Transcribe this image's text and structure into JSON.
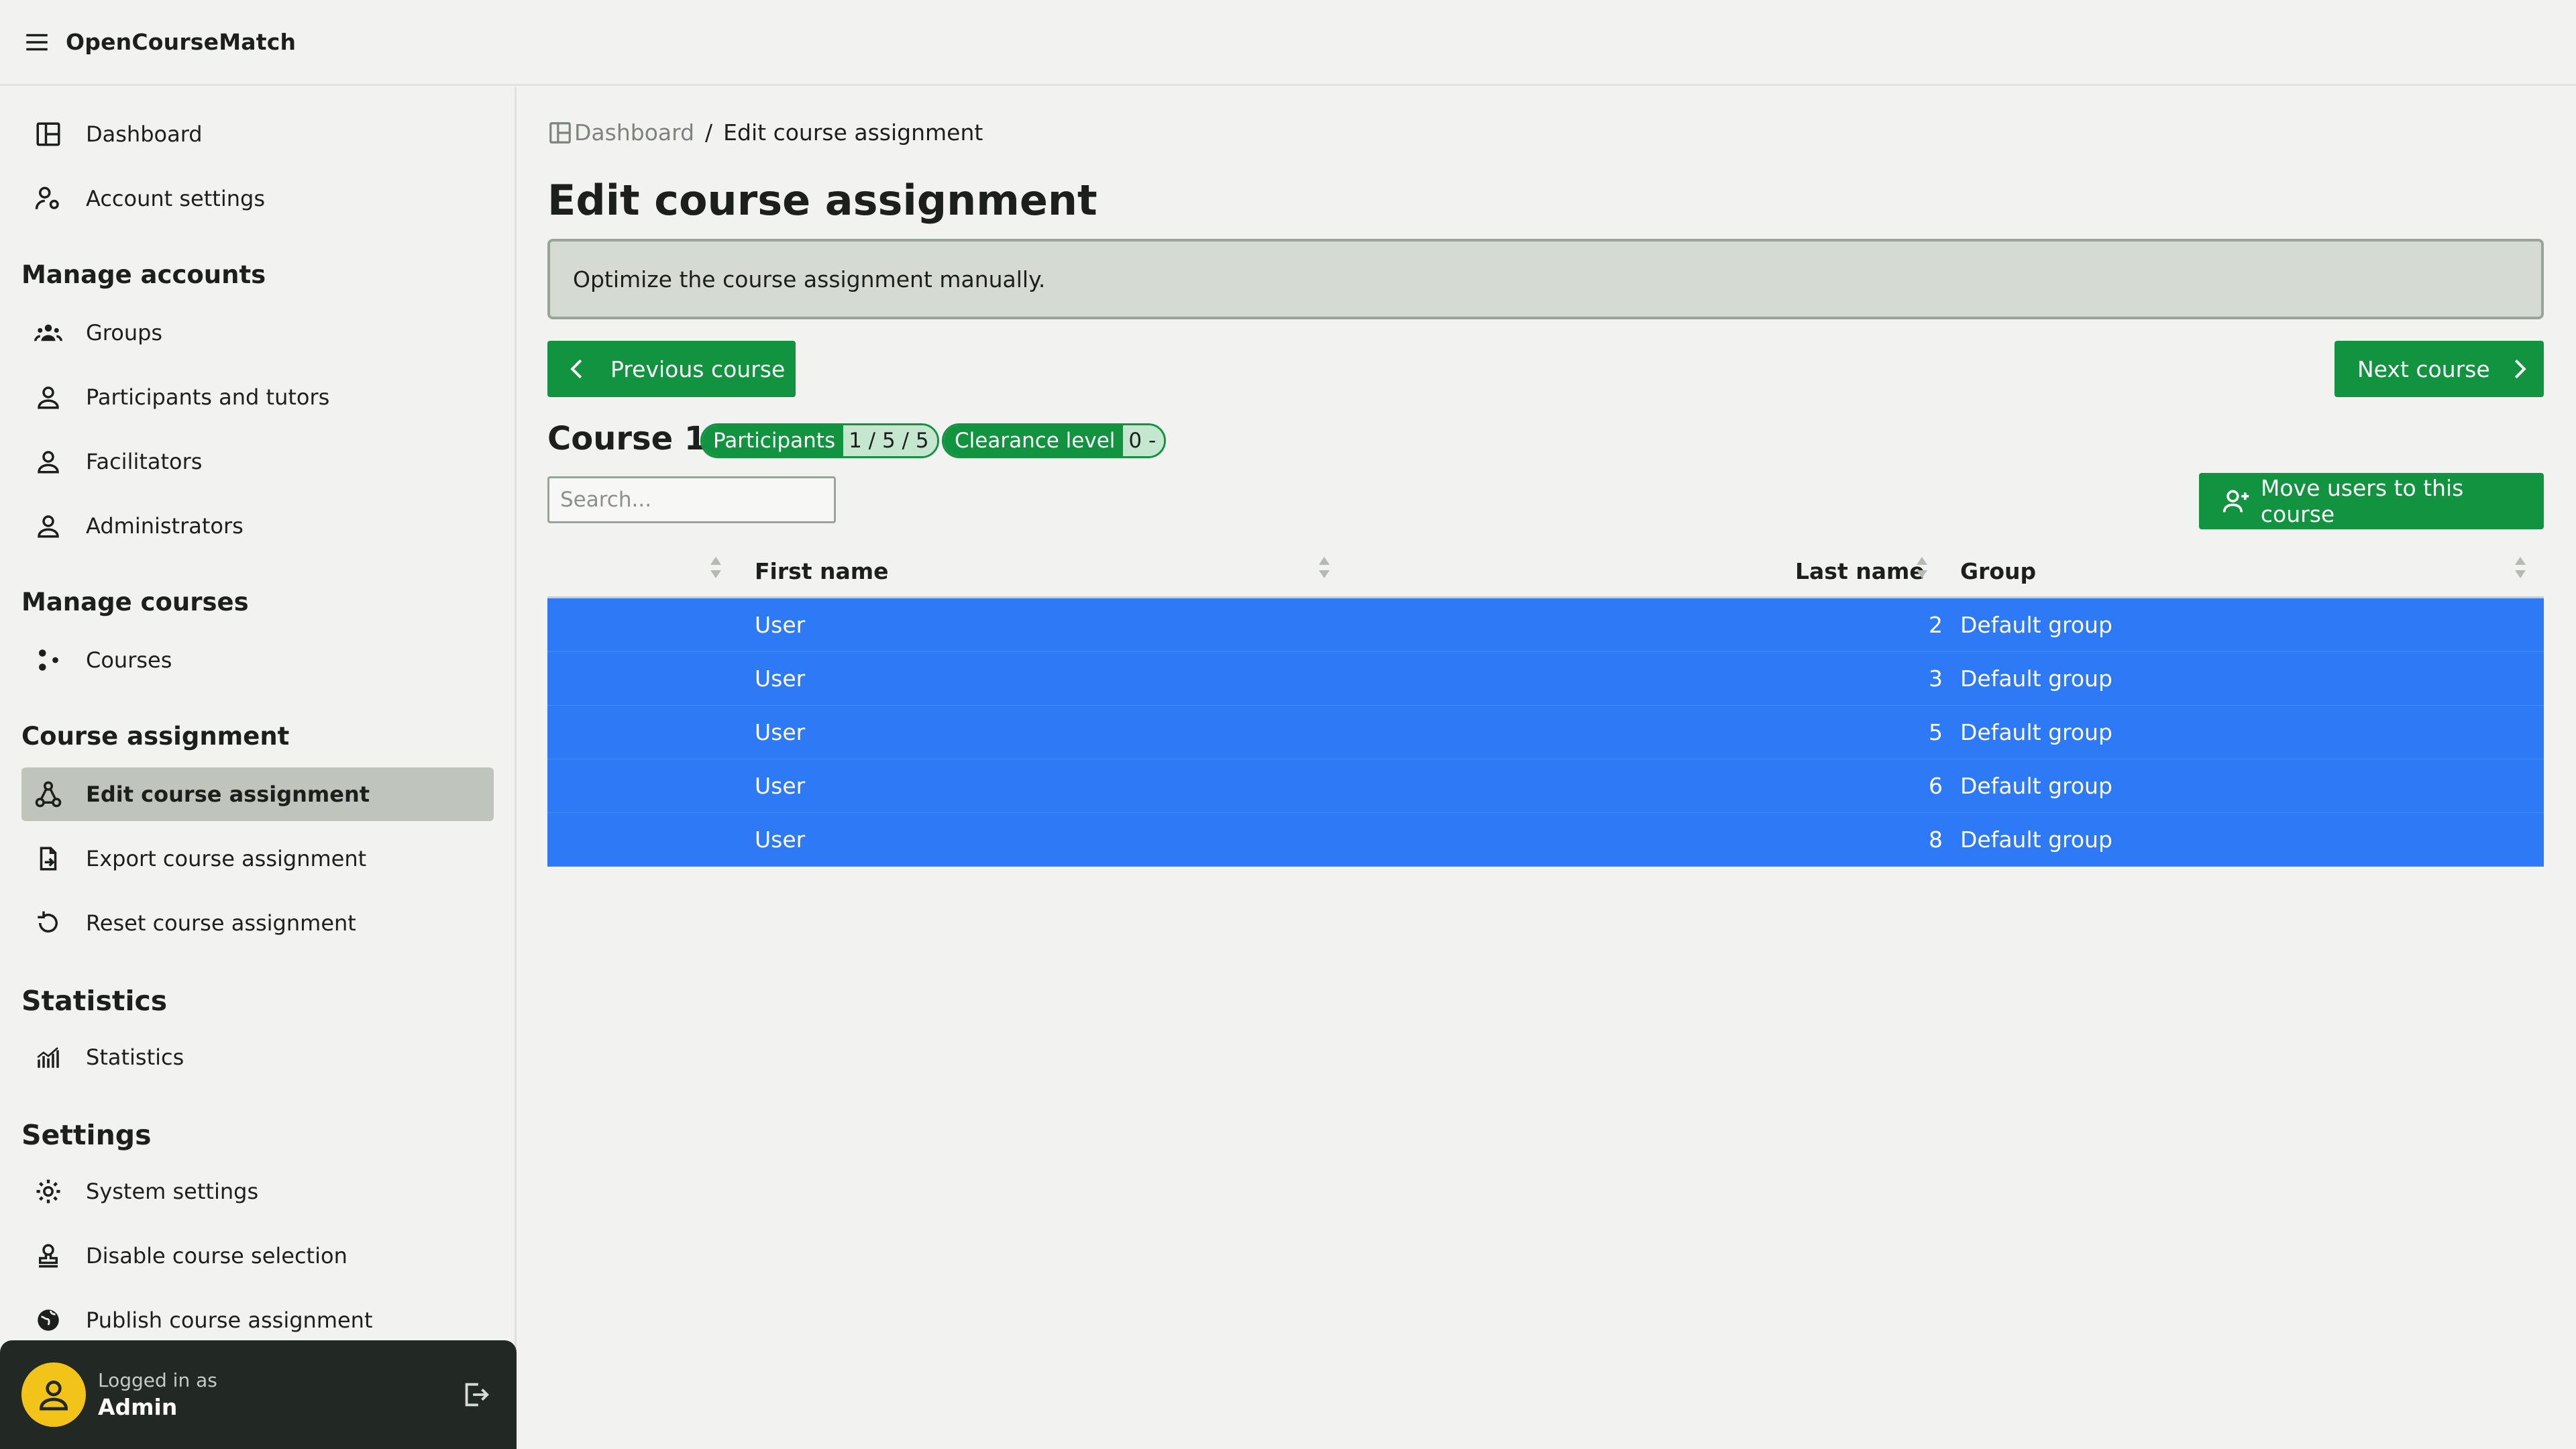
{
  "app": {
    "title": "OpenCourseMatch"
  },
  "sidebar": {
    "items_top": [
      {
        "label": "Dashboard",
        "icon": "dashboard-icon"
      },
      {
        "label": "Account settings",
        "icon": "user-gear-icon"
      }
    ],
    "sections": [
      {
        "title": "Manage accounts",
        "items": [
          {
            "label": "Groups",
            "icon": "groups-icon"
          },
          {
            "label": "Participants and tutors",
            "icon": "person-icon"
          },
          {
            "label": "Facilitators",
            "icon": "person-icon"
          },
          {
            "label": "Administrators",
            "icon": "person-icon"
          }
        ]
      },
      {
        "title": "Manage courses",
        "items": [
          {
            "label": "Courses",
            "icon": "courses-icon"
          }
        ]
      },
      {
        "title": "Course assignment",
        "items": [
          {
            "label": "Edit course assignment",
            "icon": "assignment-icon",
            "active": true
          },
          {
            "label": "Export course assignment",
            "icon": "export-icon"
          },
          {
            "label": "Reset course assignment",
            "icon": "reset-icon"
          }
        ]
      },
      {
        "title": "Statistics",
        "items": [
          {
            "label": "Statistics",
            "icon": "chart-icon"
          }
        ]
      },
      {
        "title": "Settings",
        "items": [
          {
            "label": "System settings",
            "icon": "gear-icon"
          },
          {
            "label": "Disable course selection",
            "icon": "stamp-icon"
          },
          {
            "label": "Publish course assignment",
            "icon": "globe-icon"
          }
        ]
      }
    ]
  },
  "user": {
    "logged_in_label": "Logged in as",
    "name": "Admin"
  },
  "breadcrumb": {
    "home": "Dashboard",
    "separator": "/",
    "current": "Edit course assignment"
  },
  "page": {
    "title": "Edit course assignment",
    "info": "Optimize the course assignment manually.",
    "prev_label": "Previous course",
    "next_label": "Next course"
  },
  "course": {
    "title": "Course 1",
    "participants_label": "Participants",
    "participants_value": "1 / 5 / 5",
    "clearance_label": "Clearance level",
    "clearance_value": "0 -"
  },
  "search": {
    "placeholder": "Search..."
  },
  "move_button": {
    "label": "Move users to this course"
  },
  "table": {
    "headers": {
      "first_name": "First name",
      "last_name": "Last name",
      "group": "Group"
    },
    "rows": [
      {
        "first_name": "User",
        "last_name": "2",
        "group": "Default group"
      },
      {
        "first_name": "User",
        "last_name": "3",
        "group": "Default group"
      },
      {
        "first_name": "User",
        "last_name": "5",
        "group": "Default group"
      },
      {
        "first_name": "User",
        "last_name": "6",
        "group": "Default group"
      },
      {
        "first_name": "User",
        "last_name": "8",
        "group": "Default group"
      }
    ]
  },
  "colors": {
    "primary": "#11933f",
    "selected_row": "#2e79f5",
    "active_nav": "#bfc5bc",
    "avatar": "#f2c318"
  }
}
